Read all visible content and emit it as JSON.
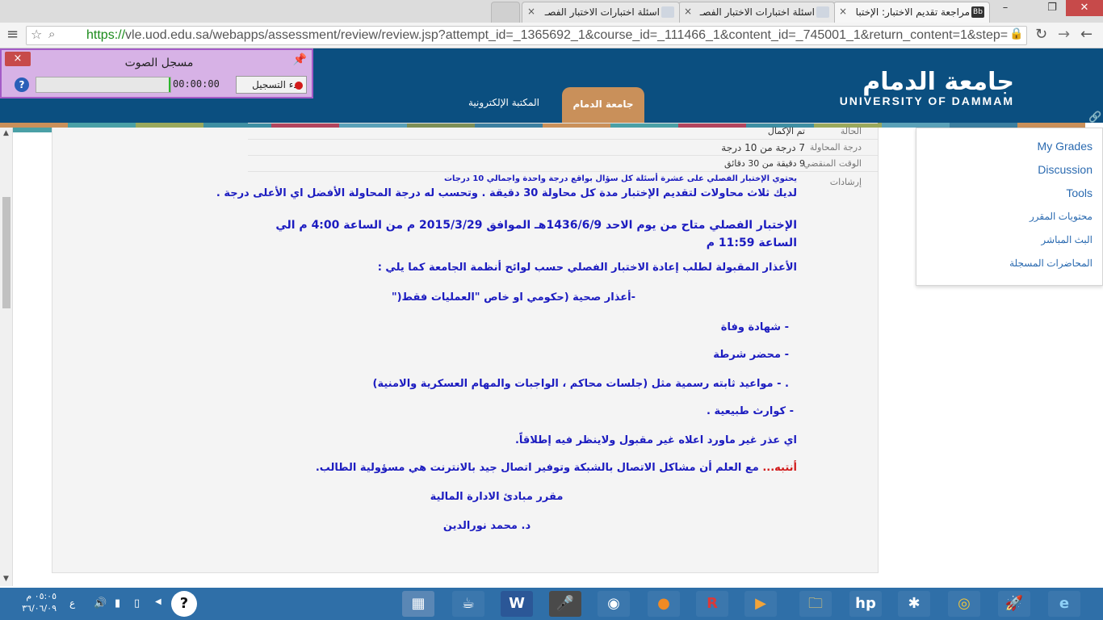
{
  "browser": {
    "tabs": [
      {
        "label": "مراجعة تقديم الاختبار: الإختبا",
        "active": true,
        "favicon": "bb-icon"
      },
      {
        "label": "اسئلة اختبارات الاختبار الفصـ",
        "active": false,
        "favicon": "doc-icon"
      },
      {
        "label": "اسئلة اختبارات الاختبار الفصـ",
        "active": false,
        "favicon": "doc-icon"
      }
    ],
    "url_scheme": "https://",
    "url_rest": "vle.uod.edu.sa/webapps/assessment/review/review.jsp?attempt_id=_1365692_1&course_id=_111466_1&content_id=_745001_1&return_content=1&step="
  },
  "recorder": {
    "title": "مسجل الصوت",
    "close": "×",
    "time": "00:00:00",
    "start_label": "بدء التسجيل",
    "help": "?"
  },
  "site": {
    "logo_ar": "جامعة الدمام",
    "logo_en": "UNIVERSITY OF DAMMAM",
    "nav_active": "جامعة الدمام",
    "nav_library": "المكتبة الإلكترونية"
  },
  "info": {
    "rows": [
      {
        "label": "الحالة",
        "value": "تم الإكمال"
      },
      {
        "label": "درجة المحاولة",
        "value": "7 درجة من 10 درجة"
      },
      {
        "label": "الوقت المنقضي",
        "value": "9 دقيقة من 30 دقائق"
      }
    ],
    "instructions_label": "إرشادات"
  },
  "instructions": {
    "line0": "يحتوي الإختبار الفصلي على عشرة أسئلة  كل سؤال بواقع درجة واحدة  واجمالي 10 درجات",
    "line1": "لديك ثلاث محاولات لتقديم الإختبار مدة كل محاولة 30 دقيقة . وتحسب له درجة المحاولة الأفضل اي الأعلى درجة .",
    "line2": "الإختبار الفصلي متاح من يوم الاحد 1436/6/9هـ الموافق 2015/3/29 م  من الساعة 4:00 م  الي الساعة 11:59 م",
    "line3": "الأعذار المقبولة لطلب إعادة الاختبار الفصلي حسب لوائح أنظمة الجامعة كما يلي :",
    "line4": "-أعذار صحية (حكومي او خاص \"العمليات فقط(\"",
    "line5": "- شهادة وفاة",
    "line6": "- محضر شرطة",
    "line7": ".    -     مواعيد ثابته رسمية مثل (جلسات محاكم ، الواجبات والمهام العسكرية والامنية)",
    "line8": "-  كوارث طبيعية .",
    "line9": "اي عذر غير ماورد اعلاه غير مقبول ولاينظر فيه إطلاقاً.",
    "warn_prefix": "أنتبه...",
    "warn_rest": " مع العلم أن مشاكل الاتصال بالشبكة وتوفير اتصال جيد بالانترنت هي مسؤولية الطالب.",
    "course": "مقرر مبادئ الادارة المالية",
    "doctor": "د. محمد نورالدين"
  },
  "right_panel": {
    "items": [
      "My Grades",
      "Discussion",
      "Tools",
      "محتويات المقرر",
      "البث المباشر",
      "المحاضرات المسجلة"
    ]
  },
  "taskbar": {
    "time": "٠٥:٠٥ م",
    "date": "٣٦/٠٦/٠٩",
    "lang": "ع"
  },
  "colors": {
    "header_blue": "#0b4f80",
    "accent_tan": "#c9905a",
    "text_blue": "#1c1cc0",
    "warn_red": "#d11a1a",
    "taskbar": "#2f6fa8"
  }
}
